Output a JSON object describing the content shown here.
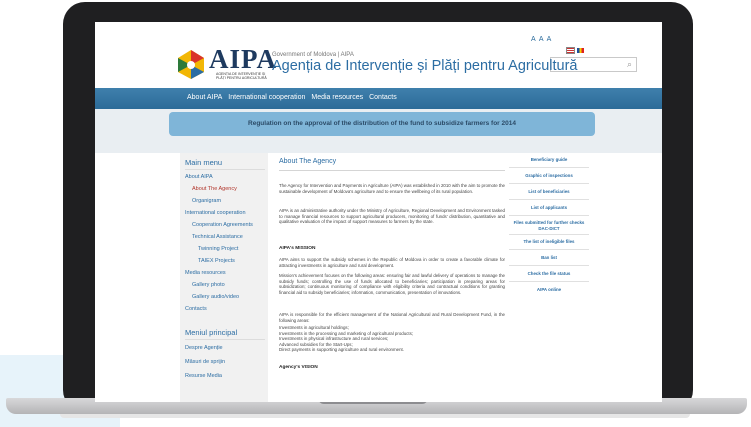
{
  "site": {
    "aaa": "A A A",
    "logo_text": "AIPA",
    "logo_subtitle": "AGENȚIA DE INTERVENȚIE ȘI PLĂȚI PENTRU AGRICULTURĂ",
    "gov_line": "Government of Moldova | AIPA",
    "agency_title": "Agenția de Intervenție și Plăți pentru Agricultură"
  },
  "nav": {
    "items": [
      "About AIPA",
      "International cooperation",
      "Media resources",
      "Contacts"
    ]
  },
  "banner": {
    "text": "Regulation on the approval of the distribution of the fund to subsidize farmers for 2014"
  },
  "left_menu": {
    "heading": "Main menu",
    "items": [
      "About AIPA",
      "About The Agency",
      "Organigram",
      "International cooperation",
      "Cooperation Agreements",
      "Technical Assistance",
      "Twinning Project",
      "TAIEX Projects",
      "Media resources",
      "Gallery photo",
      "Gallery audio/video",
      "Contacts"
    ],
    "heading2": "Meniul principal",
    "items2": [
      "Despre Agenție",
      "Măsuri de sprijin",
      "Resurse Media"
    ]
  },
  "main": {
    "heading": "About The Agency",
    "p1": "The Agency for Intervention and Payments in Agriculture (AIPA) was established in 2010 with the aim to promote the sustainable development of Moldova's agriculture and to ensure the wellbeing of its rural population.",
    "p2": "AIPA is an administrative authority under the Ministry of Agriculture, Regional Development and Environment tasked to manage financial resources to support agricultural producers, monitoring of funds' distribution, quantitative and qualitative evaluation of the impact of support measures to farmers by the state.",
    "mission_heading": "AIPA's MISSION",
    "p3": "AIPA aims to support the subsidy schemes in the Republic of Moldova in order to create a favorable climate for attracting investments in agriculture and rural development.",
    "p4": "Mission's achievement focuses on the following areas: ensuring fair and lawful delivery of operations to manage the subsidy funds; controlling the use of funds allocated to beneficiaries; participation in preparing areas for subsidization; continuous monitoring of compliance with eligibility criteria and contractual conditions for granting financial aid to subsidy beneficiaries; information, communication, presentation of innovations.",
    "p5": "AIPA is responsible for the efficient management of the National Agricultural and Rural Development Fund, in the following areas:",
    "areas": [
      "Investments in agricultural holdings;",
      "Investments in the processing and marketing of agricultural products;",
      "Investments in physical infrastructure and rural services;",
      "Advanced subsidies for the Start-Ups;",
      "Direct payments in supporting agriculture and rural environment."
    ],
    "vision_heading": "Agency's VISION"
  },
  "right_links": [
    "Beneficiary guide",
    "Graphic of inspections",
    "List of beneficiaries",
    "List of applicants",
    "Files submitted for further checks DAC-DICT",
    "The list of ineligible files",
    "Ban list",
    "Check the file status",
    "AIPA online"
  ],
  "colors": {
    "nav_bg": "#2c6b98",
    "banner_bg": "#7fb5d8",
    "link": "#2c6da3",
    "active": "#b1342a"
  }
}
